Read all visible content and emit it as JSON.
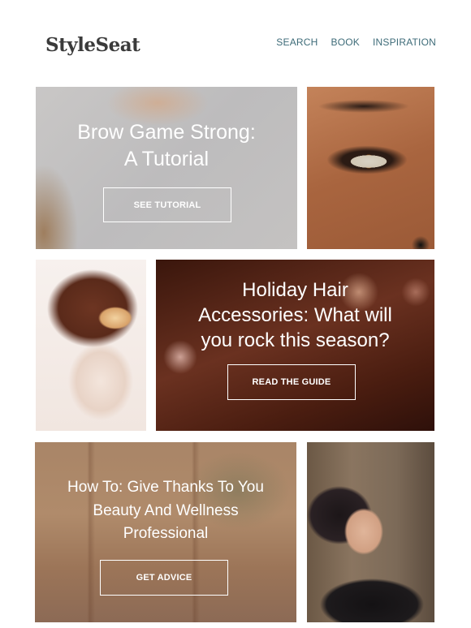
{
  "header": {
    "logo": "StyleSeat",
    "nav": [
      {
        "label": "SEARCH"
      },
      {
        "label": "BOOK"
      },
      {
        "label": "INSPIRATION"
      }
    ]
  },
  "tiles": {
    "brow": {
      "title_line1": "Brow Game Strong:",
      "title_line2": "A Tutorial",
      "button": "SEE TUTORIAL"
    },
    "holiday": {
      "title_line1": "Holiday Hair",
      "title_line2": "Accessories: What will",
      "title_line3": "you rock this season?",
      "button": "READ THE GUIDE"
    },
    "thanks": {
      "title_line1": "How To: Give Thanks To You",
      "title_line2": "Beauty And Wellness",
      "title_line3": "Professional",
      "button": "GET ADVICE"
    }
  }
}
